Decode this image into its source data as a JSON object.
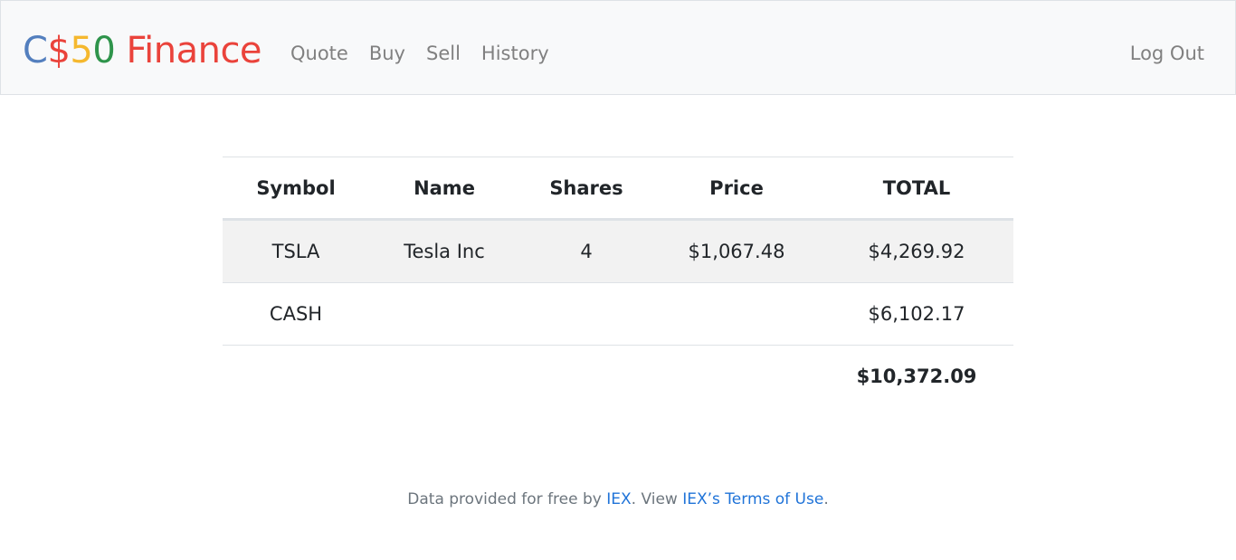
{
  "navbar": {
    "brand": {
      "parts": [
        {
          "text": "C",
          "color": "#537fbe"
        },
        {
          "text": "$",
          "color": "#ea433b"
        },
        {
          "text": "5",
          "color": "#f5b82e"
        },
        {
          "text": "0",
          "color": "#2e944b"
        },
        {
          "text": " Finance",
          "color": "#ea433b"
        }
      ]
    },
    "links": [
      "Quote",
      "Buy",
      "Sell",
      "History"
    ],
    "logout": "Log Out"
  },
  "table": {
    "headers": [
      "Symbol",
      "Name",
      "Shares",
      "Price",
      "TOTAL"
    ],
    "rows": [
      [
        "TSLA",
        "Tesla Inc",
        "4",
        "$1,067.48",
        "$4,269.92"
      ],
      [
        "CASH",
        "",
        "",
        "",
        "$6,102.17"
      ]
    ],
    "grand_total": "$10,372.09"
  },
  "footer": {
    "prefix": "Data provided for free by ",
    "iex_link": "IEX",
    "middle": ". View ",
    "terms_link": "IEX’s Terms of Use",
    "suffix": "."
  },
  "colors": {
    "link": "#1f73d8",
    "nav_text": "#808080",
    "navbar_bg": "#f8f9fa",
    "stripe": "#f2f2f2"
  }
}
